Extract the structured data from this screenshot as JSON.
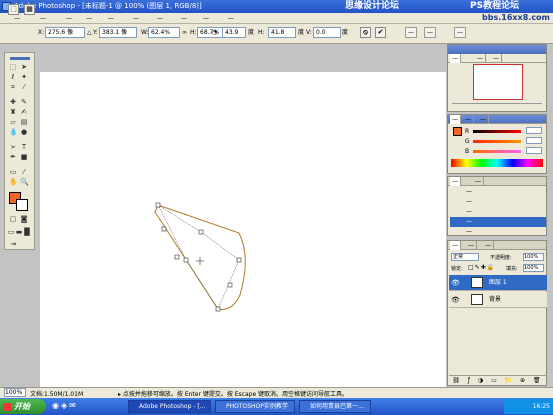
{
  "window": {
    "title": "Adobe Photoshop - [未标题-1 @ 100% (图层 1, RGB/8)]"
  },
  "watermark": {
    "left": "思缘设计论坛",
    "right": "PS教程论坛",
    "url": "bbs.16xx8.com"
  },
  "menus": [
    "—",
    "—",
    "—",
    "—",
    "—",
    "—",
    "—",
    "—",
    "—",
    "—"
  ],
  "options": {
    "x_label": "X:",
    "x_value": "275.6 像",
    "y_label": "Y:",
    "y_value": "383.1 像",
    "w_label": "W:",
    "w_value": "62.4%",
    "h_label": "H:",
    "h_value": "68.7%",
    "angle_value": "43.9",
    "angle_unit": "度",
    "hskew_label": "H:",
    "hskew_value": "41.8",
    "hskew_unit": "度",
    "vskew_label": "V:",
    "vskew_value": "0.0",
    "vskew_unit": "度",
    "cancel_icon": "cancel-transform-icon",
    "commit_icon": "commit-transform-icon",
    "tabs": [
      "—",
      "—",
      "—"
    ]
  },
  "tools": {
    "foreground_color": "#f26522",
    "background_color": "#ffffff"
  },
  "navigator_panel": {
    "tabs": [
      "—",
      "—",
      "—"
    ]
  },
  "color_panel": {
    "tabs": [
      "—",
      "—",
      "—"
    ],
    "channels": [
      "R",
      "G",
      "B"
    ],
    "foreground": "#f26522"
  },
  "history_panel": {
    "tabs": [
      "—",
      "—"
    ],
    "items": [
      "—",
      "—",
      "—",
      "—",
      "—"
    ],
    "selected_index": 4
  },
  "layers_panel": {
    "tabs": [
      "—",
      "—",
      "—"
    ],
    "blend_mode": "正常",
    "opacity_label": "不透明度:",
    "opacity_value": "100%",
    "lock_label": "锁定:",
    "fill_label": "填充:",
    "fill_value": "100%",
    "layers": [
      {
        "name": "图层 1",
        "selected": true
      },
      {
        "name": "背景",
        "selected": false
      }
    ]
  },
  "status": {
    "zoom": "100%",
    "doc_info": "文档:1.50M/1.01M",
    "hint": "▸ 点按并拖移可缩放。按 Enter 键提交。按 Escape 键取消。用空格键访问导航工具。"
  },
  "taskbar": {
    "start": "开始",
    "tasks": [
      "Adobe Photoshop - [...",
      "PHOTOSHOP实例教学",
      "如何用青县巴第一..."
    ],
    "clock": "16:25"
  }
}
